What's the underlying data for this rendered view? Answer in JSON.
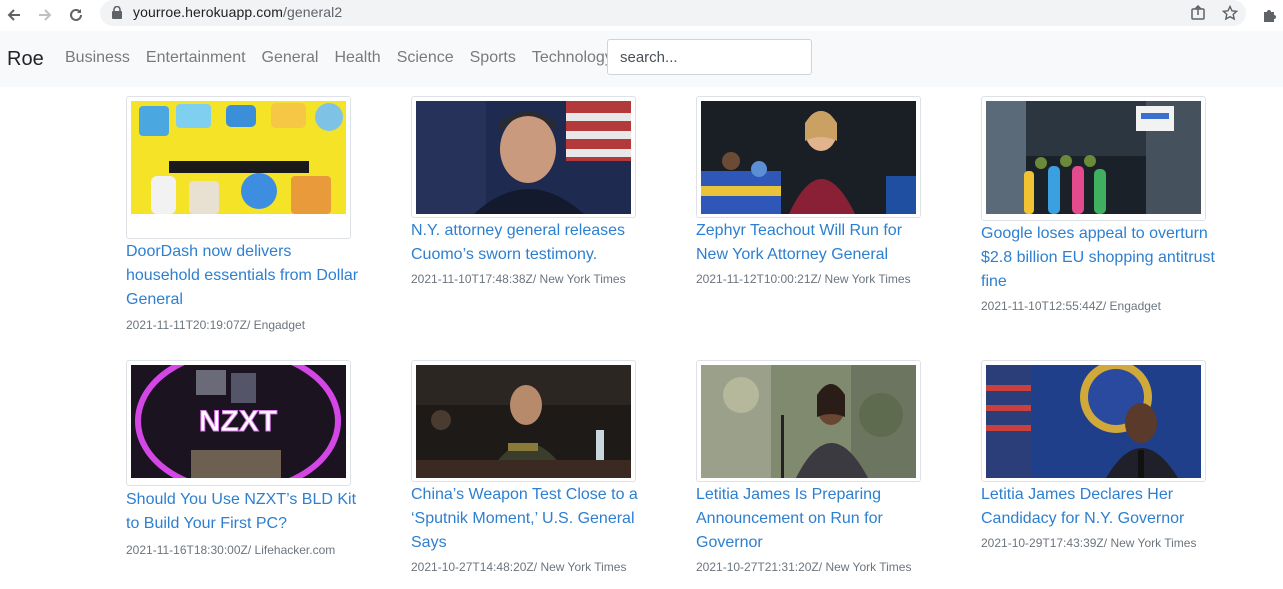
{
  "browser": {
    "url_host": "yourroe.herokuapp.com",
    "url_path": "/general2"
  },
  "navbar": {
    "brand": "Roe",
    "links": [
      "Business",
      "Entertainment",
      "General",
      "Health",
      "Science",
      "Sports",
      "Technology"
    ],
    "search_placeholder": "search..."
  },
  "articles": [
    {
      "title": "DoorDash now delivers household essentials from Dollar General",
      "date": "2021-11-11T20:19:07Z",
      "source": "Engadget",
      "image": "doordash-dollar-general-products"
    },
    {
      "title": "N.Y. attorney general releases Cuomo’s sworn testimony.",
      "date": "2021-11-10T17:48:38Z",
      "source": "New York Times",
      "image": "cuomo-press-conference"
    },
    {
      "title": "Zephyr Teachout Will Run for New York Attorney General",
      "date": "2021-11-12T10:00:21Z",
      "source": "New York Times",
      "image": "teachout-speaking-podium"
    },
    {
      "title": "Google loses appeal to overturn $2.8 billion EU shopping antitrust fine",
      "date": "2021-11-10T12:55:44Z",
      "source": "Engadget",
      "image": "google-office-entrance"
    },
    {
      "title": "Should You Use NZXT’s BLD Kit to Build Your First PC?",
      "date": "2021-11-16T18:30:00Z",
      "source": "Lifehacker.com",
      "image": "nzxt-neon-logo",
      "image_text": "NZXT"
    },
    {
      "title": "China’s Weapon Test Close to a ‘Sputnik Moment,’ U.S. General Says",
      "date": "2021-10-27T14:48:20Z",
      "source": "New York Times",
      "image": "general-testifying-hearing"
    },
    {
      "title": "Letitia James Is Preparing Announcement on Run for Governor",
      "date": "2021-10-27T21:31:20Z",
      "source": "New York Times",
      "image": "letitia-james-outdoors"
    },
    {
      "title": "Letitia James Declares Her Candidacy for N.Y. Governor",
      "date": "2021-10-29T17:43:39Z",
      "source": "New York Times",
      "image": "letitia-james-state-seal"
    }
  ],
  "colors": {
    "link": "#2d7fd0",
    "meta": "#6c757d",
    "navbar_bg": "#f8f9fa"
  }
}
